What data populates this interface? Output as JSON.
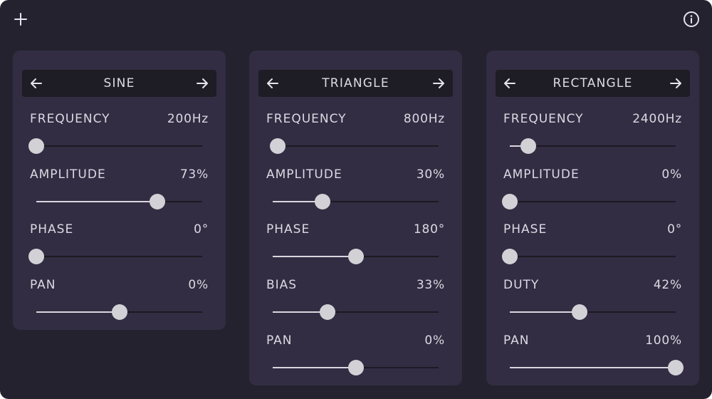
{
  "toolbar": {
    "add_icon": "plus-icon",
    "info_icon": "info-icon"
  },
  "panels": [
    {
      "title": "SINE",
      "params": [
        {
          "label": "FREQUENCY",
          "value": "200Hz",
          "level": 0.0
        },
        {
          "label": "AMPLITUDE",
          "value": "73%",
          "level": 0.73
        },
        {
          "label": "PHASE",
          "value": "0°",
          "level": 0.0
        },
        {
          "label": "PAN",
          "value": "0%",
          "level": 0.5
        }
      ]
    },
    {
      "title": "TRIANGLE",
      "params": [
        {
          "label": "FREQUENCY",
          "value": "800Hz",
          "level": 0.03
        },
        {
          "label": "AMPLITUDE",
          "value": "30%",
          "level": 0.3
        },
        {
          "label": "PHASE",
          "value": "180°",
          "level": 0.5
        },
        {
          "label": "BIAS",
          "value": "33%",
          "level": 0.33
        },
        {
          "label": "PAN",
          "value": "0%",
          "level": 0.5
        }
      ]
    },
    {
      "title": "RECTANGLE",
      "params": [
        {
          "label": "FREQUENCY",
          "value": "2400Hz",
          "level": 0.11
        },
        {
          "label": "AMPLITUDE",
          "value": "0%",
          "level": 0.0
        },
        {
          "label": "PHASE",
          "value": "0°",
          "level": 0.0
        },
        {
          "label": "DUTY",
          "value": "42%",
          "level": 0.42
        },
        {
          "label": "PAN",
          "value": "100%",
          "level": 1.0
        }
      ]
    }
  ],
  "colors": {
    "background": "#25222f",
    "panel": "#322d43",
    "header": "#1e1c24",
    "text": "#dcd9e2",
    "track": "#1c1a22",
    "fill": "#d9d7de",
    "thumb": "#d2d1d6"
  }
}
